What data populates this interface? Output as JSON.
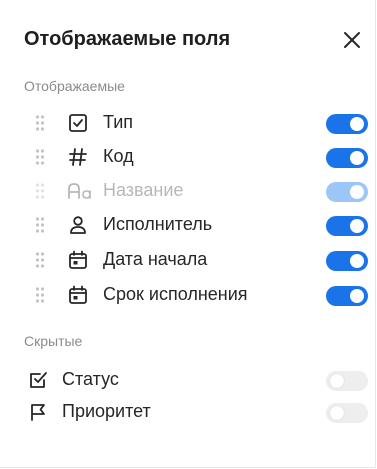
{
  "panel": {
    "title": "Отображаемые поля"
  },
  "sections": {
    "visible": "Отображаемые",
    "hidden": "Скрытые"
  },
  "visible_fields": [
    {
      "label": "Тип",
      "icon": "checkbox-square-icon",
      "enabled": true,
      "locked": false
    },
    {
      "label": "Код",
      "icon": "hash-icon",
      "enabled": true,
      "locked": false
    },
    {
      "label": "Название",
      "icon": "text-font-icon",
      "enabled": true,
      "locked": true
    },
    {
      "label": "Исполнитель",
      "icon": "person-icon",
      "enabled": true,
      "locked": false
    },
    {
      "label": "Дата начала",
      "icon": "calendar-icon",
      "enabled": true,
      "locked": false
    },
    {
      "label": "Срок исполнения",
      "icon": "calendar-icon",
      "enabled": true,
      "locked": false
    }
  ],
  "hidden_fields": [
    {
      "label": "Статус",
      "icon": "checkbox-check-icon",
      "enabled": false
    },
    {
      "label": "Приоритет",
      "icon": "flag-icon",
      "enabled": false
    }
  ],
  "colors": {
    "accent": "#1a73e8",
    "accent_disabled": "#9cc6f6",
    "toggle_off": "#eeeeee",
    "muted_text": "#8b8b8b"
  }
}
